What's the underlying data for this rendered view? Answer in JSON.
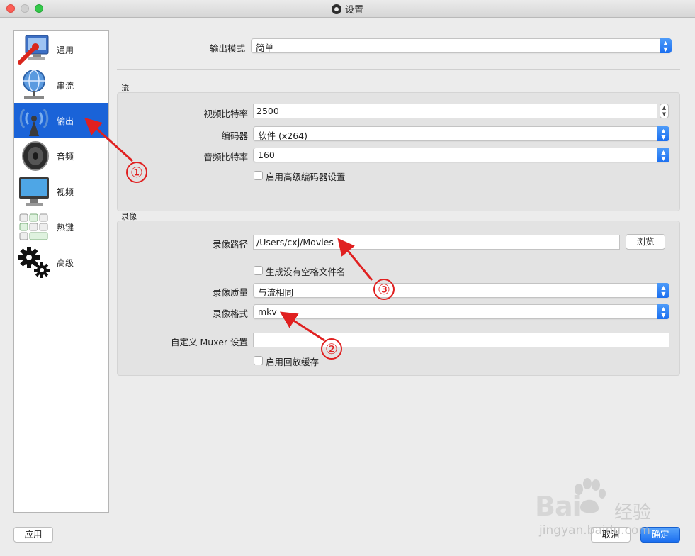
{
  "window": {
    "title": "设置"
  },
  "sidebar": {
    "items": [
      {
        "label": "通用",
        "icon": "wrench-monitor-icon"
      },
      {
        "label": "串流",
        "icon": "globe-network-icon"
      },
      {
        "label": "输出",
        "icon": "broadcast-antenna-icon"
      },
      {
        "label": "音频",
        "icon": "speaker-icon"
      },
      {
        "label": "视频",
        "icon": "monitor-icon"
      },
      {
        "label": "热键",
        "icon": "keyboard-icon"
      },
      {
        "label": "高级",
        "icon": "gears-icon"
      }
    ],
    "active": "输出"
  },
  "output_mode": {
    "label": "输出模式",
    "value": "简单"
  },
  "stream": {
    "title": "流",
    "video_bitrate": {
      "label": "视频比特率",
      "value": "2500"
    },
    "encoder": {
      "label": "编码器",
      "value": "软件 (x264)"
    },
    "audio_bitrate": {
      "label": "音频比特率",
      "value": "160"
    },
    "advanced_encoder": {
      "label": "启用高级编码器设置"
    }
  },
  "recording": {
    "title": "录像",
    "path": {
      "label": "录像路径",
      "value": "/Users/cxj/Movies",
      "browse_label": "浏览"
    },
    "no_space_filename": {
      "label": "生成没有空格文件名"
    },
    "quality": {
      "label": "录像质量",
      "value": "与流相同"
    },
    "format": {
      "label": "录像格式",
      "value": "mkv"
    },
    "muxer": {
      "label": "自定义 Muxer 设置",
      "value": ""
    },
    "replay_buffer": {
      "label": "启用回放缓存"
    }
  },
  "buttons": {
    "apply": "应用",
    "cancel": "取消",
    "ok": "确定"
  },
  "annotations": [
    "①",
    "②",
    "③"
  ],
  "watermark": {
    "brand": "Bai",
    "cn": "经验",
    "url": "jingyan.baidu.com"
  },
  "colors": {
    "accent": "#1a63d8",
    "annotation": "#e02020"
  }
}
